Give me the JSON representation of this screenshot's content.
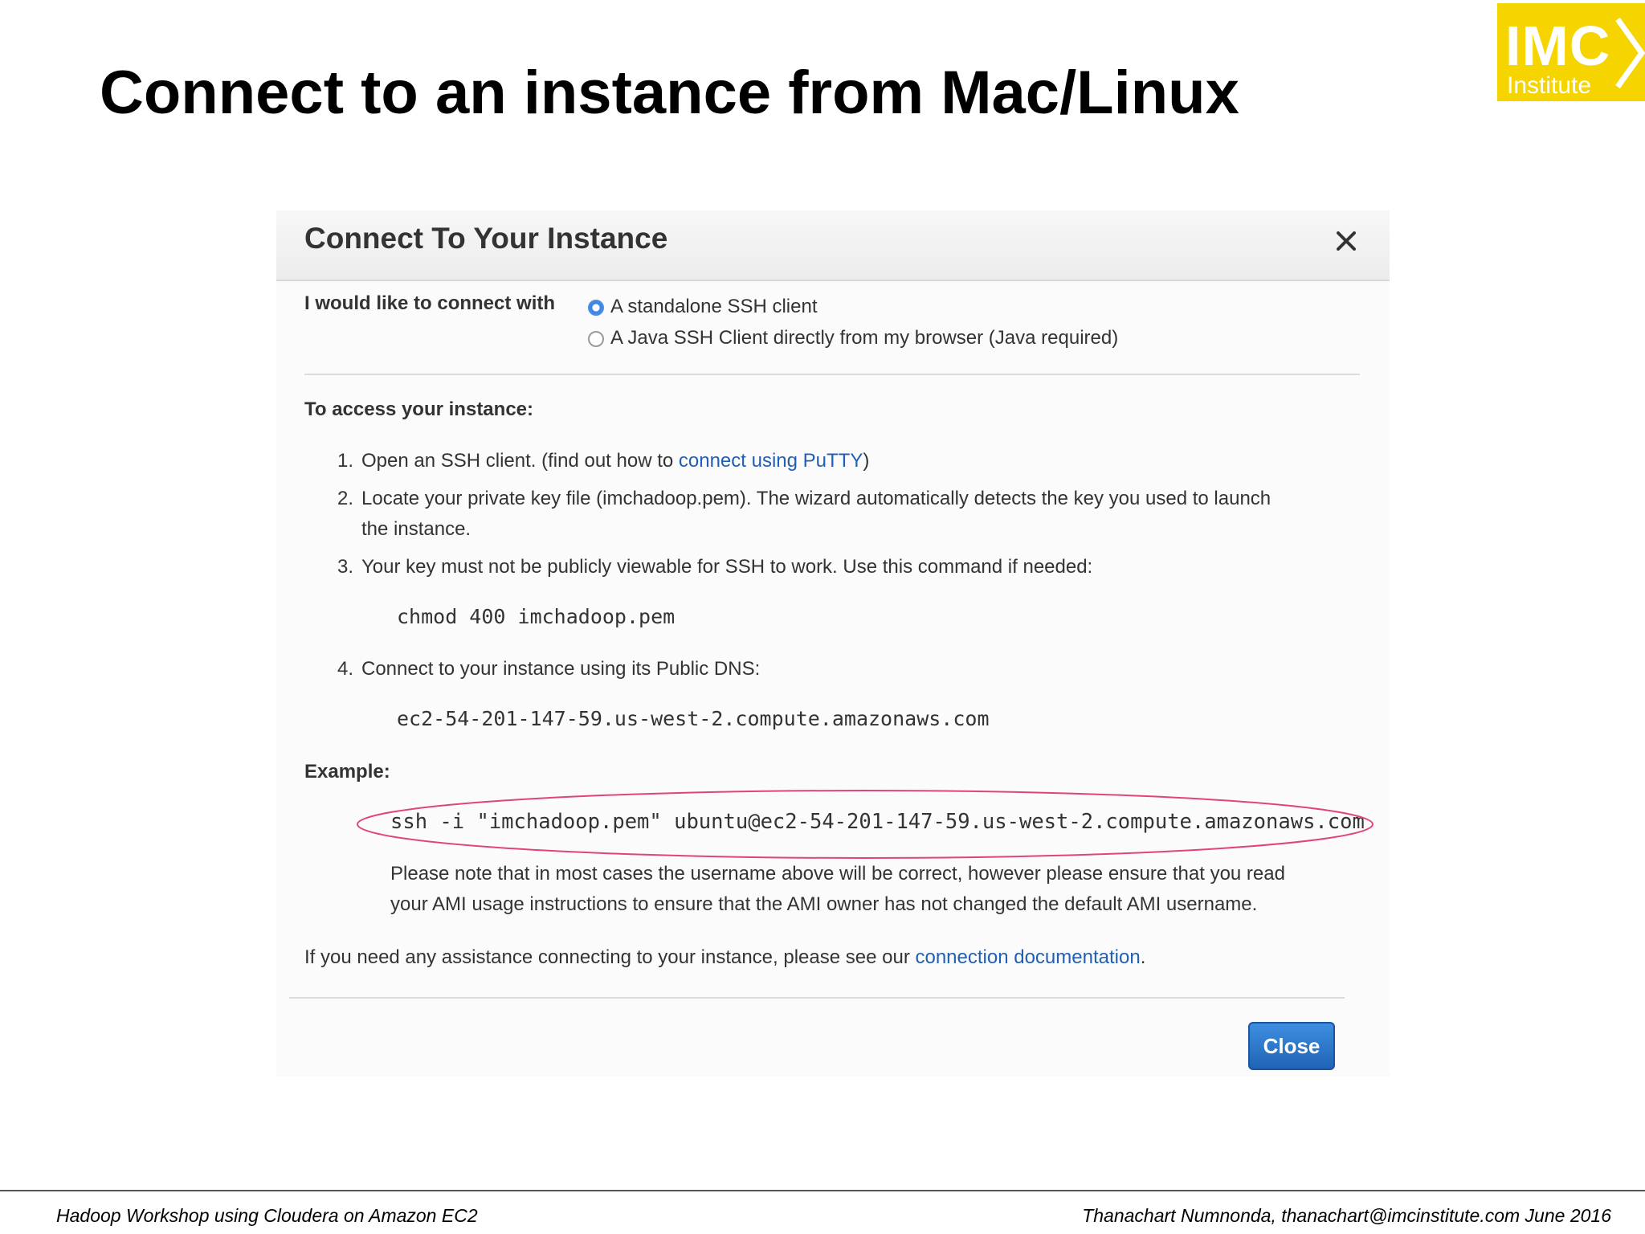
{
  "slide": {
    "title": "Connect to an instance from Mac/Linux"
  },
  "logo": {
    "line1": "IMC",
    "line2": "Institute",
    "color": "#f6d400"
  },
  "dialog": {
    "title": "Connect To Your Instance",
    "close_icon": "close-icon",
    "connect_with_label": "I would like to connect with",
    "options": [
      {
        "label": "A standalone SSH client",
        "selected": true
      },
      {
        "label": "A Java SSH Client directly from my browser (Java required)",
        "selected": false
      }
    ],
    "access_heading": "To access your instance:",
    "steps": {
      "s1_num": "1.",
      "s1_text": "Open an SSH client. (find out how to",
      "s1_link": "connect using PuTTY",
      "s1_close": ")",
      "s2_num": "2.",
      "s2_line1": "Locate your private key file (imchadoop.pem). The wizard automatically detects the key you used to launch",
      "s2_line2": "the instance.",
      "s3_num": "3.",
      "s3_text": "Your key must not be publicly viewable for SSH to work. Use this command if needed:",
      "s3_cmd": "chmod 400 imchadoop.pem",
      "s4_num": "4.",
      "s4_text": "Connect to your instance using its Public DNS:",
      "s4_dns": "ec2-54-201-147-59.us-west-2.compute.amazonaws.com"
    },
    "example_heading": "Example:",
    "example_cmd": "ssh -i \"imchadoop.pem\" ubuntu@ec2-54-201-147-59.us-west-2.compute.amazonaws.com",
    "note_line1": "Please note that in most cases the username above will be correct, however please ensure that you read",
    "note_line2": "your AMI usage instructions to ensure that the AMI owner has not changed the default AMI username.",
    "assist_text": "If you need any assistance connecting to your instance, please see our",
    "assist_link": "connection documentation",
    "assist_end": ".",
    "close_button": "Close",
    "accent_color": "#1f63b6",
    "highlight_color": "#e0457a"
  },
  "footer": {
    "left": "Hadoop Workshop using Cloudera on Amazon EC2",
    "right": "Thanachart Numnonda,  thanachart@imcinstitute.com  June 2016"
  }
}
